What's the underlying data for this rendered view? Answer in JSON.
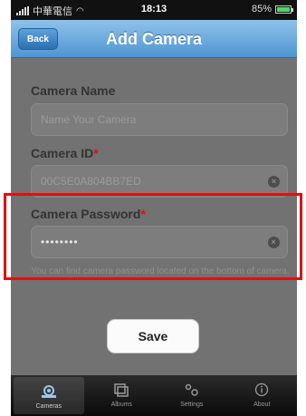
{
  "status_bar": {
    "carrier": "中華電信",
    "time": "18:13",
    "battery": "85%"
  },
  "navbar": {
    "back_label": "Back",
    "title": "Add Camera"
  },
  "form": {
    "camera_name": {
      "label": "Camera Name",
      "placeholder": "Name Your Camera"
    },
    "camera_id": {
      "label": "Camera ID",
      "required_mark": "*",
      "value": "00C5E0A804BB7ED"
    },
    "camera_password": {
      "label": "Camera Password",
      "required_mark": "*",
      "value": "••••••••"
    },
    "hint": "You can find camera password located on the bottom of camera."
  },
  "save_label": "Save",
  "tabs": [
    {
      "label": "Cameras",
      "icon": "camera-icon",
      "active": true
    },
    {
      "label": "Albums",
      "icon": "albums-icon",
      "active": false
    },
    {
      "label": "Settings",
      "icon": "settings-icon",
      "active": false
    },
    {
      "label": "About",
      "icon": "info-icon",
      "active": false
    }
  ],
  "colors": {
    "navbar": "#5a9dd8",
    "required": "#d8111a",
    "highlight": "#e01010"
  }
}
